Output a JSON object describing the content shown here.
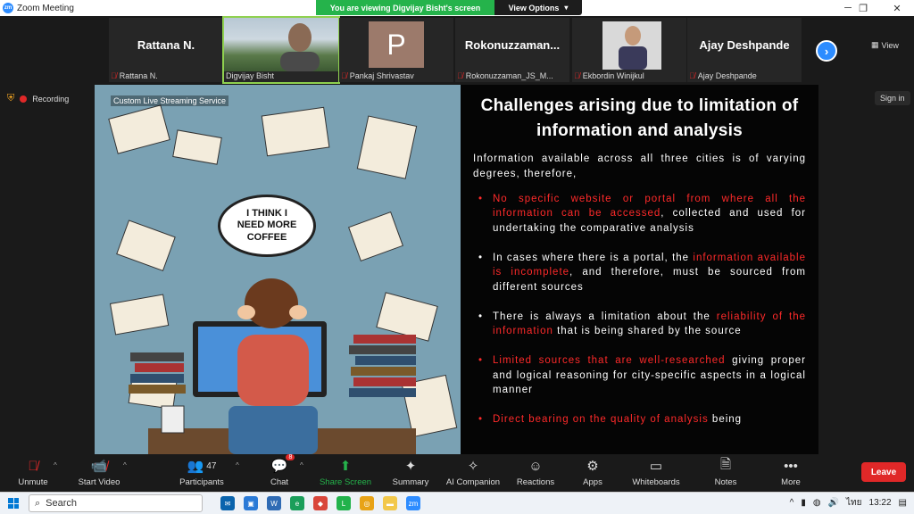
{
  "window": {
    "title": "Zoom Meeting",
    "app_icon": "zm"
  },
  "banner": {
    "viewing_text": "You are viewing Digvijay Bisht's screen",
    "view_options_label": "View Options"
  },
  "participants": [
    {
      "big_name": "Rattana N.",
      "name": "Rattana N.",
      "muted": true,
      "type": "name"
    },
    {
      "big_name": "",
      "name": "Digvijay Bisht",
      "muted": false,
      "type": "video",
      "active": true
    },
    {
      "big_name": "P",
      "name": "Pankaj Shrivastav",
      "muted": true,
      "type": "avatar"
    },
    {
      "big_name": "Rokonuzzaman...",
      "name": "Rokonuzzaman_JS_M...",
      "muted": true,
      "type": "name"
    },
    {
      "big_name": "",
      "name": "Ekbordin Winijkul",
      "muted": true,
      "type": "video"
    },
    {
      "big_name": "Ajay Deshpande",
      "name": "Ajay Deshpande",
      "muted": true,
      "type": "name"
    }
  ],
  "strip_view_label": "View",
  "status": {
    "recording_label": "Recording",
    "sign_in_label": "Sign in"
  },
  "illustration": {
    "watermark": "Custom Live Streaming Service",
    "bubble_line1": "I THINK I",
    "bubble_line2": "NEED MORE",
    "bubble_line3": "COFFEE"
  },
  "slide": {
    "title": "Challenges arising due to limitation of information and analysis",
    "intro": "Information available across all three cities is of varying degrees, therefore,",
    "bullets": [
      {
        "red": "No specific website or portal from where all the information can be accessed",
        "rest": ", collected and used for undertaking the comparative analysis",
        "red_bullet": true,
        "pre": ""
      },
      {
        "pre": "In cases where there is a portal, the ",
        "red": "information available is incomplete",
        "rest": ", and therefore, must be sourced from different sources",
        "red_bullet": false
      },
      {
        "pre": "There is always a limitation about the ",
        "red": "reliability of the information",
        "rest": " that is being shared by the source",
        "red_bullet": false
      },
      {
        "pre": "",
        "red": "Limited sources that are well-researched",
        "rest": " giving proper and logical reasoning for city-specific aspects in a logical manner",
        "red_bullet": true
      },
      {
        "pre": "",
        "red": "Direct bearing on the quality of analysis",
        "rest": " being",
        "red_bullet": true
      }
    ]
  },
  "toolbar": {
    "unmute": "Unmute",
    "start_video": "Start Video",
    "participants": "Participants",
    "participants_count": "47",
    "chat": "Chat",
    "chat_badge": "8",
    "share_screen": "Share Screen",
    "summary": "Summary",
    "ai_companion": "AI Companion",
    "reactions": "Reactions",
    "apps": "Apps",
    "whiteboards": "Whiteboards",
    "notes": "Notes",
    "more": "More",
    "leave": "Leave"
  },
  "taskbar": {
    "search_label": "Search",
    "time": "13:22",
    "lang": "ไทย"
  },
  "colors": {
    "accent_red": "#ff2a2a",
    "zoom_blue": "#2d8cff",
    "share_green": "#25b34b"
  }
}
